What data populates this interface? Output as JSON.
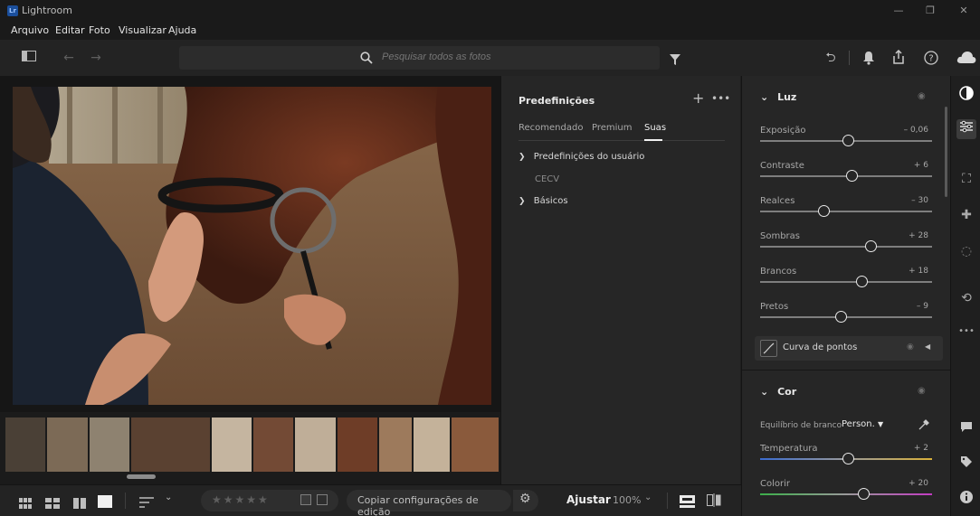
{
  "app": {
    "title": "Lightroom",
    "logo_text": "Lr"
  },
  "menu": [
    "Arquivo",
    "Editar",
    "Foto",
    "Visualizar",
    "Ajuda"
  ],
  "search": {
    "placeholder": "Pesquisar todos as fotos"
  },
  "presets": {
    "title": "Predefinições",
    "tabs": [
      "Recomendado",
      "Premium",
      "Suas"
    ],
    "active_tab": "Suas",
    "groups": [
      {
        "label": "Predefinições do usuário",
        "expanded": true,
        "items": [
          "CECV"
        ]
      },
      {
        "label": "Básicos",
        "expanded": false,
        "items": []
      }
    ]
  },
  "light": {
    "title": "Luz",
    "sliders": [
      {
        "label": "Exposição",
        "value": "– 0,06",
        "position": 0.51
      },
      {
        "label": "Contraste",
        "value": "+ 6",
        "position": 0.53
      },
      {
        "label": "Realces",
        "value": "– 30",
        "position": 0.37
      },
      {
        "label": "Sombras",
        "value": "+ 28",
        "position": 0.64
      },
      {
        "label": "Brancos",
        "value": "+ 18",
        "position": 0.59
      },
      {
        "label": "Pretos",
        "value": "– 9",
        "position": 0.47
      }
    ],
    "curve_label": "Curva de pontos"
  },
  "color": {
    "title": "Cor",
    "white_balance_label": "Equilíbrio de branco",
    "white_balance_value": "Person.",
    "sliders": [
      {
        "label": "Temperatura",
        "value": "+ 2",
        "position": 0.51
      },
      {
        "label": "Colorir",
        "value": "+ 20",
        "position": 0.6
      }
    ]
  },
  "bottombar": {
    "copy_label": "Copiar configurações de edição",
    "fit_label": "Ajustar",
    "zoom": "100%"
  },
  "colors": {
    "accent": "#2680eb",
    "panel": "#262626",
    "background": "#1e1e1e"
  }
}
